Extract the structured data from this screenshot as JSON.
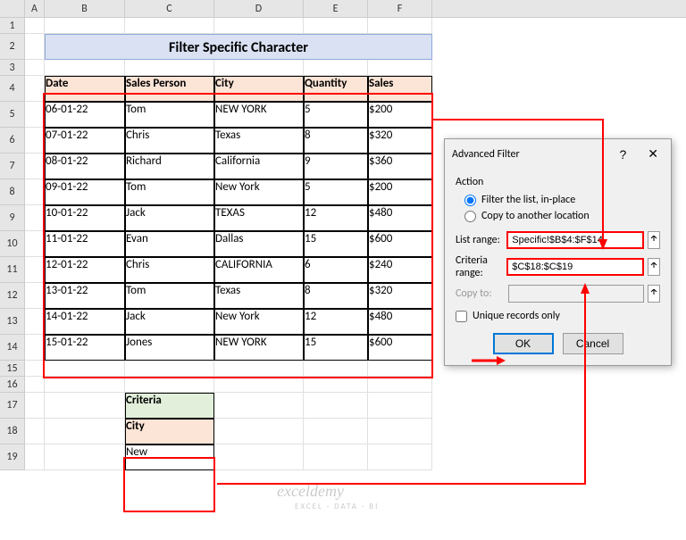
{
  "columns": [
    "A",
    "B",
    "C",
    "D",
    "E",
    "F"
  ],
  "title": "Filter Specific Character",
  "headers": [
    "Date",
    "Sales Person",
    "City",
    "Quantity",
    "Sales"
  ],
  "rows": [
    [
      "06-01-22",
      "Tom",
      "NEW YORK",
      "5",
      "$200"
    ],
    [
      "07-01-22",
      "Chris",
      "Texas",
      "8",
      "$320"
    ],
    [
      "08-01-22",
      "Richard",
      "California",
      "9",
      "$360"
    ],
    [
      "09-01-22",
      "Tom",
      "New York",
      "5",
      "$200"
    ],
    [
      "10-01-22",
      "Jack",
      "TEXAS",
      "12",
      "$480"
    ],
    [
      "11-01-22",
      "Evan",
      "Dallas",
      "15",
      "$600"
    ],
    [
      "12-01-22",
      "Chris",
      "CALIFORNIA",
      "6",
      "$240"
    ],
    [
      "13-01-22",
      "Tom",
      "Texas",
      "8",
      "$320"
    ],
    [
      "14-01-22",
      "Jack",
      "New York",
      "12",
      "$480"
    ],
    [
      "15-01-22",
      "Jones",
      "NEW YORK",
      "15",
      "$600"
    ]
  ],
  "criteria": {
    "header": "Criteria",
    "field": "City",
    "value": "New"
  },
  "dialog": {
    "title": "Advanced Filter",
    "action_label": "Action",
    "radio1": "Filter the list, in-place",
    "radio2": "Copy to another location",
    "list_range_label": "List range:",
    "list_range_value": "Specific!$B$4:$F$14",
    "criteria_range_label": "Criteria range:",
    "criteria_range_value": "$C$18:$C$19",
    "copy_to_label": "Copy to:",
    "copy_to_value": "",
    "unique_label": "Unique records only",
    "ok": "OK",
    "cancel": "Cancel",
    "help": "?",
    "close": "✕"
  },
  "watermark": "exceldemy",
  "watermark_sub": "EXCEL · DATA · BI"
}
